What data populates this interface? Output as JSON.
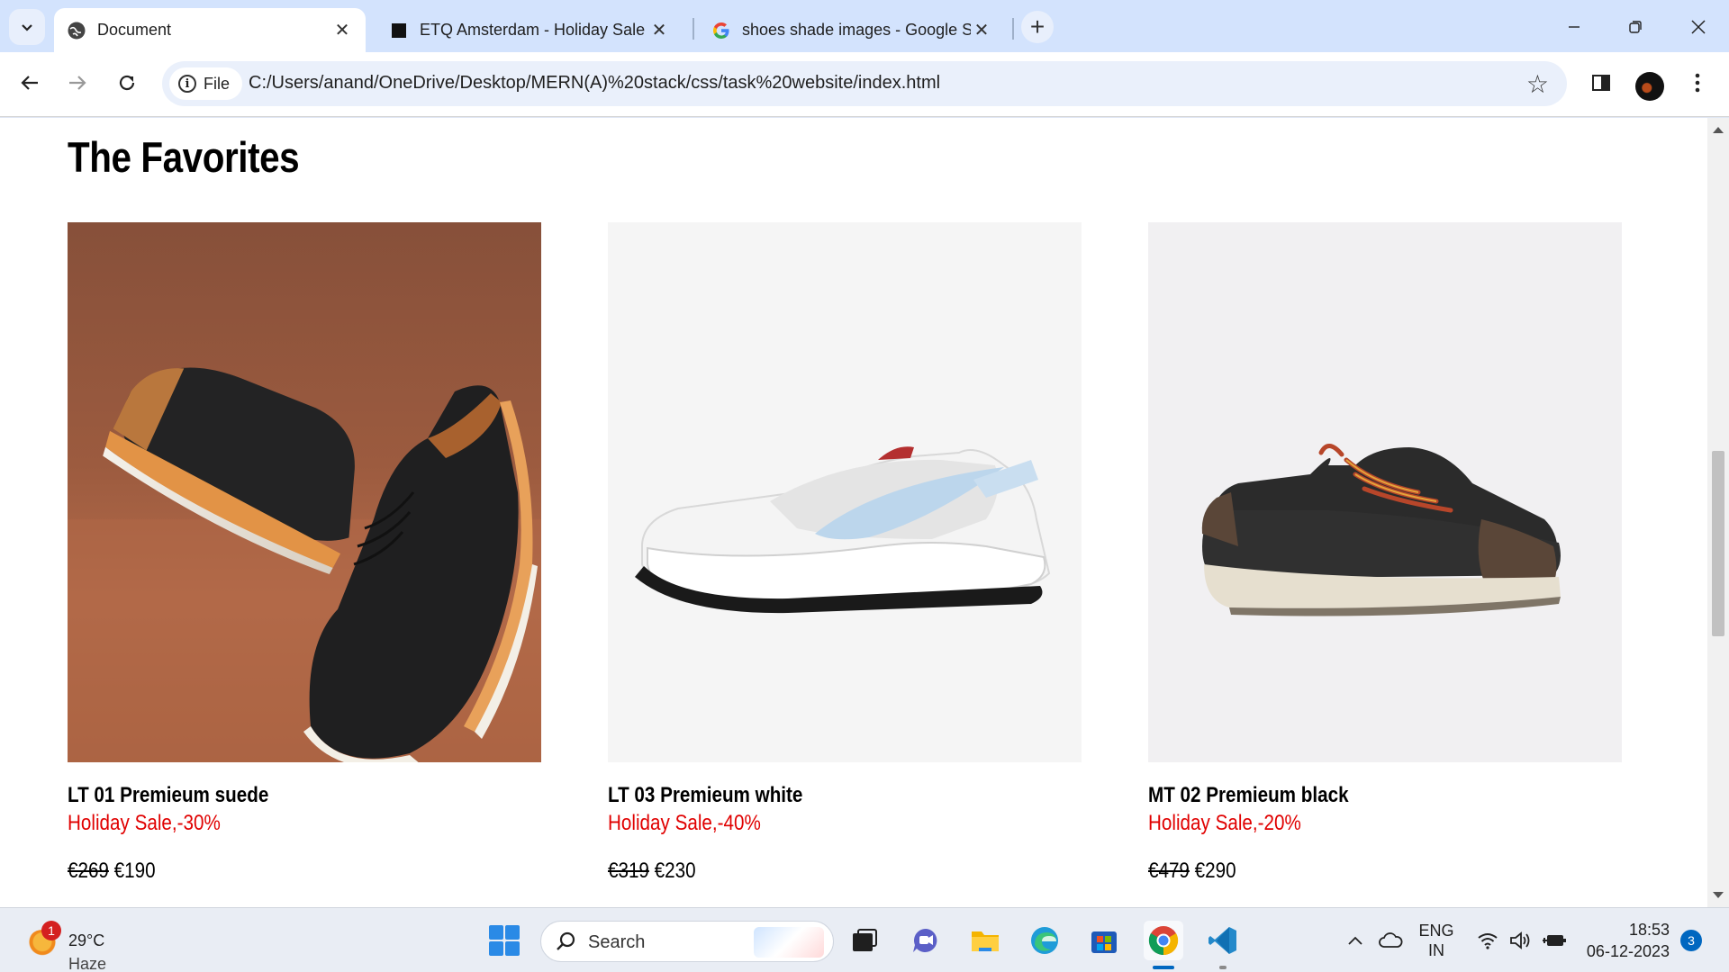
{
  "browser": {
    "tabs": [
      {
        "title": "Document",
        "icon": "globe-icon",
        "active": true
      },
      {
        "title": "ETQ Amsterdam - Holiday Sale",
        "icon": "square-favicon-icon",
        "active": false
      },
      {
        "title": "shoes shade images - Google S",
        "icon": "google-icon",
        "active": false
      }
    ],
    "omnibox": {
      "chip_label": "File",
      "url": "C:/Users/anand/OneDrive/Desktop/MERN(A)%20stack/css/task%20website/index.html"
    }
  },
  "page": {
    "section_title": "The Favorites",
    "products": [
      {
        "name": "LT 01 Premieum suede",
        "sale": "Holiday Sale,-30%",
        "old_price": "€269",
        "new_price": "€190",
        "image": "black-suede-derby-shoes"
      },
      {
        "name": "LT 03 Premieum white",
        "sale": "Holiday Sale,-40%",
        "old_price": "€319",
        "new_price": "€230",
        "image": "white-sneaker"
      },
      {
        "name": "MT 02 Premieum black",
        "sale": "Holiday Sale,-20%",
        "old_price": "€479",
        "new_price": "€290",
        "image": "black-reebok-sneaker"
      }
    ],
    "colors": {
      "sale": "#e00000",
      "page_bg": "#ffffff"
    }
  },
  "taskbar": {
    "weather": {
      "badge": "1",
      "temp": "29°C",
      "condition": "Haze"
    },
    "search_label": "Search",
    "language": {
      "line1": "ENG",
      "line2": "IN"
    },
    "time": "18:53",
    "date": "06-12-2023",
    "notifications": "3"
  }
}
